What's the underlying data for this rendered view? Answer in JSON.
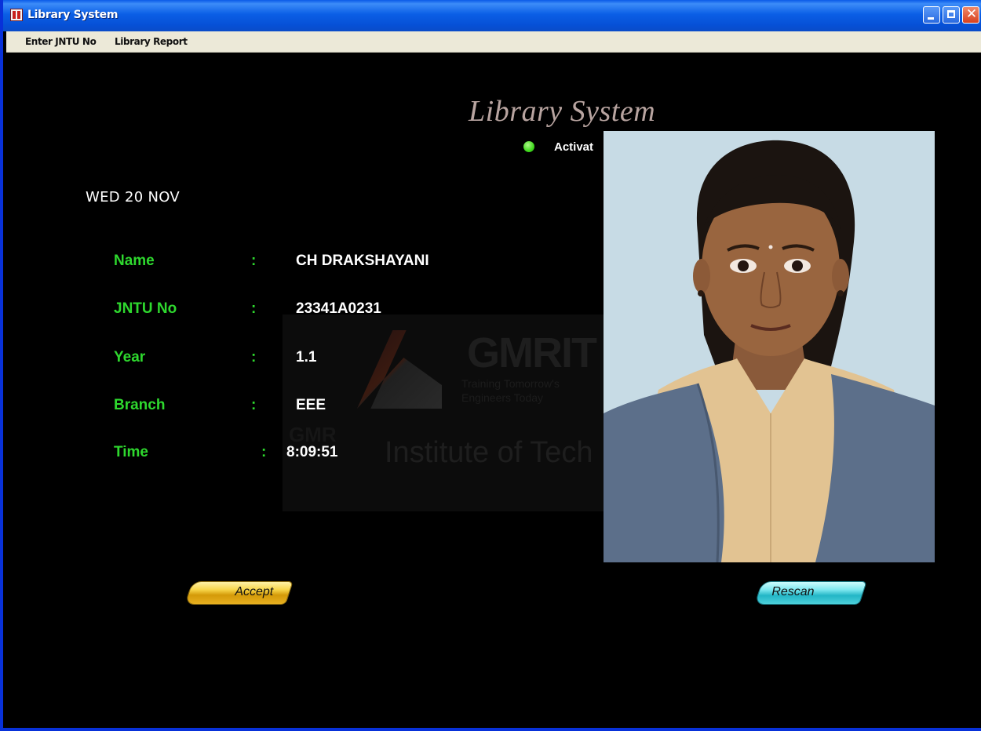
{
  "window": {
    "title": "Library System",
    "minimize_icon": "minimize-icon",
    "maximize_icon": "maximize-icon",
    "close_icon": "close-icon"
  },
  "menu": {
    "items": [
      {
        "label": "Enter JNTU No"
      },
      {
        "label": "Library Report"
      }
    ]
  },
  "header": {
    "title": "Library System",
    "status_text": "Activat",
    "status_color": "#3fd91c"
  },
  "date": "WED 20 NOV",
  "fields": [
    {
      "label": "Name",
      "value": "CH DRAKSHAYANI"
    },
    {
      "label": "JNTU No",
      "value": "23341A0231"
    },
    {
      "label": "Year",
      "value": "1.1"
    },
    {
      "label": "Branch",
      "value": "EEE"
    },
    {
      "label": "Time",
      "value": "8:09:51"
    }
  ],
  "colon": ":",
  "watermark": {
    "name": "GMRIT",
    "tagline_1": "Training Tomorrow's",
    "tagline_2": "Engineers Today",
    "institute": "Institute of Tech",
    "small_text": "GMR"
  },
  "buttons": {
    "accept_label": "Accept",
    "rescan_label": "Rescan",
    "accept_color": "#f8d64a",
    "rescan_color": "#7ee8f0"
  },
  "colors": {
    "label_green": "#2ed82e",
    "background": "#000000",
    "titlebar_blue": "#0b5fe6"
  }
}
